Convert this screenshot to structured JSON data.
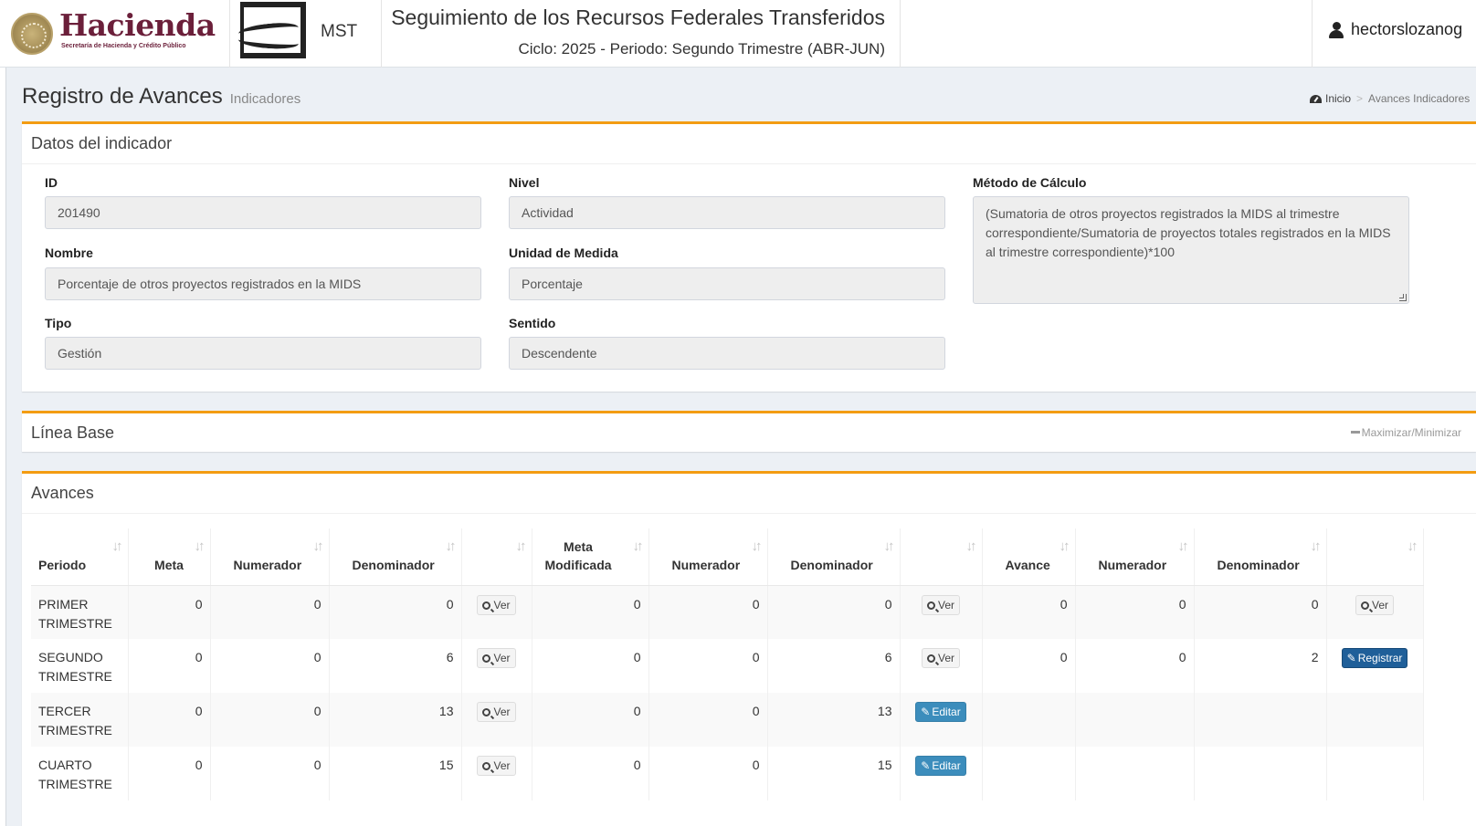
{
  "header": {
    "brand_word": "Hacienda",
    "brand_sub": "Secretaría de Hacienda y Crédito Público",
    "mst_label": "MST",
    "title": "Seguimiento de los Recursos Federales Transferidos",
    "subtitle": "Ciclo: 2025 - Periodo: Segundo Trimestre (ABR-JUN)",
    "user": "hectorslozanog"
  },
  "page": {
    "title": "Registro de Avances",
    "subtitle": "Indicadores",
    "breadcrumb": {
      "home": "Inicio",
      "current": "Avances Indicadores"
    }
  },
  "datos": {
    "title": "Datos del indicador",
    "id_label": "ID",
    "id_value": "201490",
    "nombre_label": "Nombre",
    "nombre_value": "Porcentaje de otros proyectos registrados en la MIDS",
    "tipo_label": "Tipo",
    "tipo_value": "Gestión",
    "nivel_label": "Nivel",
    "nivel_value": "Actividad",
    "unidad_label": "Unidad de Medida",
    "unidad_value": "Porcentaje",
    "sentido_label": "Sentido",
    "sentido_value": "Descendente",
    "metodo_label": "Método de Cálculo",
    "metodo_value": "(Sumatoria de otros proyectos  registrados la MIDS al trimestre correspondiente/Sumatoria de proyectos totales registrados en la MIDS al trimestre correspondiente)*100"
  },
  "linea_base": {
    "title": "Línea Base",
    "toggle": "Maximizar/Minimizar"
  },
  "avances": {
    "title": "Avances",
    "columns": [
      "Periodo",
      "Meta",
      "Numerador",
      "Denominador",
      "",
      "Meta Modificada",
      "Numerador",
      "Denominador",
      "",
      "Avance",
      "Numerador",
      "Denominador",
      ""
    ],
    "rows": [
      {
        "periodo": "PRIMER TRIMESTRE",
        "meta": "0",
        "num1": "0",
        "den1": "0",
        "btn1": "Ver",
        "meta_mod": "0",
        "num2": "0",
        "den2": "0",
        "btn2": "Ver",
        "avance": "0",
        "num3": "0",
        "den3": "0",
        "btn3": "Ver"
      },
      {
        "periodo": "SEGUNDO TRIMESTRE",
        "meta": "0",
        "num1": "0",
        "den1": "6",
        "btn1": "Ver",
        "meta_mod": "0",
        "num2": "0",
        "den2": "6",
        "btn2": "Ver",
        "avance": "0",
        "num3": "0",
        "den3": "2",
        "btn3": "Registrar"
      },
      {
        "periodo": "TERCER TRIMESTRE",
        "meta": "0",
        "num1": "0",
        "den1": "13",
        "btn1": "Ver",
        "meta_mod": "0",
        "num2": "0",
        "den2": "13",
        "btn2": "Editar",
        "avance": "",
        "num3": "",
        "den3": "",
        "btn3": ""
      },
      {
        "periodo": "CUARTO TRIMESTRE",
        "meta": "0",
        "num1": "0",
        "den1": "15",
        "btn1": "Ver",
        "meta_mod": "0",
        "num2": "0",
        "den2": "15",
        "btn2": "Editar",
        "avance": "",
        "num3": "",
        "den3": "",
        "btn3": ""
      }
    ]
  },
  "colors": {
    "accent": "#f39c12",
    "brand": "#6b1f3a",
    "info": "#3c8dbc",
    "primary": "#1f5f99"
  },
  "icons": {
    "user": "user-icon",
    "dashboard": "dashboard-icon",
    "view": "search-plus-icon",
    "edit": "pencil-icon",
    "sort": "sort-icon",
    "minimize": "minus-icon"
  }
}
